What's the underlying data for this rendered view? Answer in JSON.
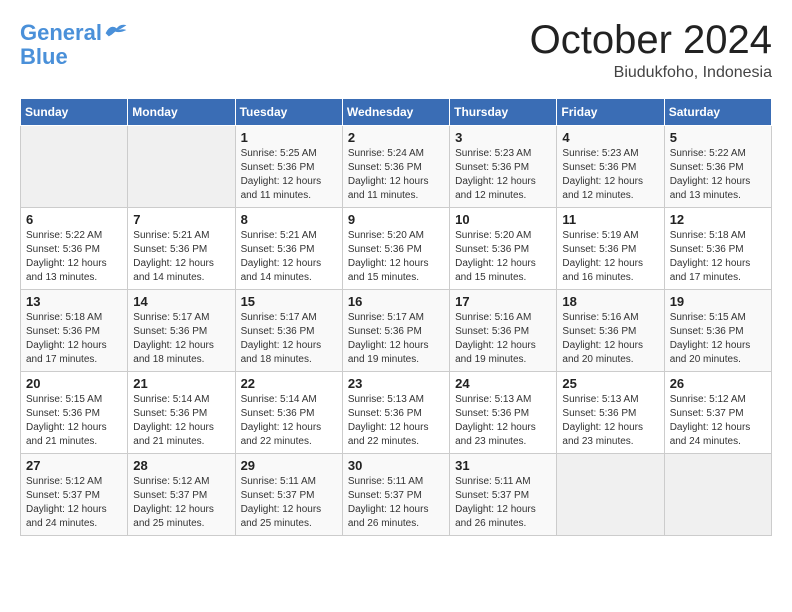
{
  "logo": {
    "line1": "General",
    "line2": "Blue"
  },
  "title": "October 2024",
  "location": "Biudukfoho, Indonesia",
  "weekdays": [
    "Sunday",
    "Monday",
    "Tuesday",
    "Wednesday",
    "Thursday",
    "Friday",
    "Saturday"
  ],
  "weeks": [
    [
      {
        "day": "",
        "detail": ""
      },
      {
        "day": "",
        "detail": ""
      },
      {
        "day": "1",
        "detail": "Sunrise: 5:25 AM\nSunset: 5:36 PM\nDaylight: 12 hours\nand 11 minutes."
      },
      {
        "day": "2",
        "detail": "Sunrise: 5:24 AM\nSunset: 5:36 PM\nDaylight: 12 hours\nand 11 minutes."
      },
      {
        "day": "3",
        "detail": "Sunrise: 5:23 AM\nSunset: 5:36 PM\nDaylight: 12 hours\nand 12 minutes."
      },
      {
        "day": "4",
        "detail": "Sunrise: 5:23 AM\nSunset: 5:36 PM\nDaylight: 12 hours\nand 12 minutes."
      },
      {
        "day": "5",
        "detail": "Sunrise: 5:22 AM\nSunset: 5:36 PM\nDaylight: 12 hours\nand 13 minutes."
      }
    ],
    [
      {
        "day": "6",
        "detail": "Sunrise: 5:22 AM\nSunset: 5:36 PM\nDaylight: 12 hours\nand 13 minutes."
      },
      {
        "day": "7",
        "detail": "Sunrise: 5:21 AM\nSunset: 5:36 PM\nDaylight: 12 hours\nand 14 minutes."
      },
      {
        "day": "8",
        "detail": "Sunrise: 5:21 AM\nSunset: 5:36 PM\nDaylight: 12 hours\nand 14 minutes."
      },
      {
        "day": "9",
        "detail": "Sunrise: 5:20 AM\nSunset: 5:36 PM\nDaylight: 12 hours\nand 15 minutes."
      },
      {
        "day": "10",
        "detail": "Sunrise: 5:20 AM\nSunset: 5:36 PM\nDaylight: 12 hours\nand 15 minutes."
      },
      {
        "day": "11",
        "detail": "Sunrise: 5:19 AM\nSunset: 5:36 PM\nDaylight: 12 hours\nand 16 minutes."
      },
      {
        "day": "12",
        "detail": "Sunrise: 5:18 AM\nSunset: 5:36 PM\nDaylight: 12 hours\nand 17 minutes."
      }
    ],
    [
      {
        "day": "13",
        "detail": "Sunrise: 5:18 AM\nSunset: 5:36 PM\nDaylight: 12 hours\nand 17 minutes."
      },
      {
        "day": "14",
        "detail": "Sunrise: 5:17 AM\nSunset: 5:36 PM\nDaylight: 12 hours\nand 18 minutes."
      },
      {
        "day": "15",
        "detail": "Sunrise: 5:17 AM\nSunset: 5:36 PM\nDaylight: 12 hours\nand 18 minutes."
      },
      {
        "day": "16",
        "detail": "Sunrise: 5:17 AM\nSunset: 5:36 PM\nDaylight: 12 hours\nand 19 minutes."
      },
      {
        "day": "17",
        "detail": "Sunrise: 5:16 AM\nSunset: 5:36 PM\nDaylight: 12 hours\nand 19 minutes."
      },
      {
        "day": "18",
        "detail": "Sunrise: 5:16 AM\nSunset: 5:36 PM\nDaylight: 12 hours\nand 20 minutes."
      },
      {
        "day": "19",
        "detail": "Sunrise: 5:15 AM\nSunset: 5:36 PM\nDaylight: 12 hours\nand 20 minutes."
      }
    ],
    [
      {
        "day": "20",
        "detail": "Sunrise: 5:15 AM\nSunset: 5:36 PM\nDaylight: 12 hours\nand 21 minutes."
      },
      {
        "day": "21",
        "detail": "Sunrise: 5:14 AM\nSunset: 5:36 PM\nDaylight: 12 hours\nand 21 minutes."
      },
      {
        "day": "22",
        "detail": "Sunrise: 5:14 AM\nSunset: 5:36 PM\nDaylight: 12 hours\nand 22 minutes."
      },
      {
        "day": "23",
        "detail": "Sunrise: 5:13 AM\nSunset: 5:36 PM\nDaylight: 12 hours\nand 22 minutes."
      },
      {
        "day": "24",
        "detail": "Sunrise: 5:13 AM\nSunset: 5:36 PM\nDaylight: 12 hours\nand 23 minutes."
      },
      {
        "day": "25",
        "detail": "Sunrise: 5:13 AM\nSunset: 5:36 PM\nDaylight: 12 hours\nand 23 minutes."
      },
      {
        "day": "26",
        "detail": "Sunrise: 5:12 AM\nSunset: 5:37 PM\nDaylight: 12 hours\nand 24 minutes."
      }
    ],
    [
      {
        "day": "27",
        "detail": "Sunrise: 5:12 AM\nSunset: 5:37 PM\nDaylight: 12 hours\nand 24 minutes."
      },
      {
        "day": "28",
        "detail": "Sunrise: 5:12 AM\nSunset: 5:37 PM\nDaylight: 12 hours\nand 25 minutes."
      },
      {
        "day": "29",
        "detail": "Sunrise: 5:11 AM\nSunset: 5:37 PM\nDaylight: 12 hours\nand 25 minutes."
      },
      {
        "day": "30",
        "detail": "Sunrise: 5:11 AM\nSunset: 5:37 PM\nDaylight: 12 hours\nand 26 minutes."
      },
      {
        "day": "31",
        "detail": "Sunrise: 5:11 AM\nSunset: 5:37 PM\nDaylight: 12 hours\nand 26 minutes."
      },
      {
        "day": "",
        "detail": ""
      },
      {
        "day": "",
        "detail": ""
      }
    ]
  ]
}
